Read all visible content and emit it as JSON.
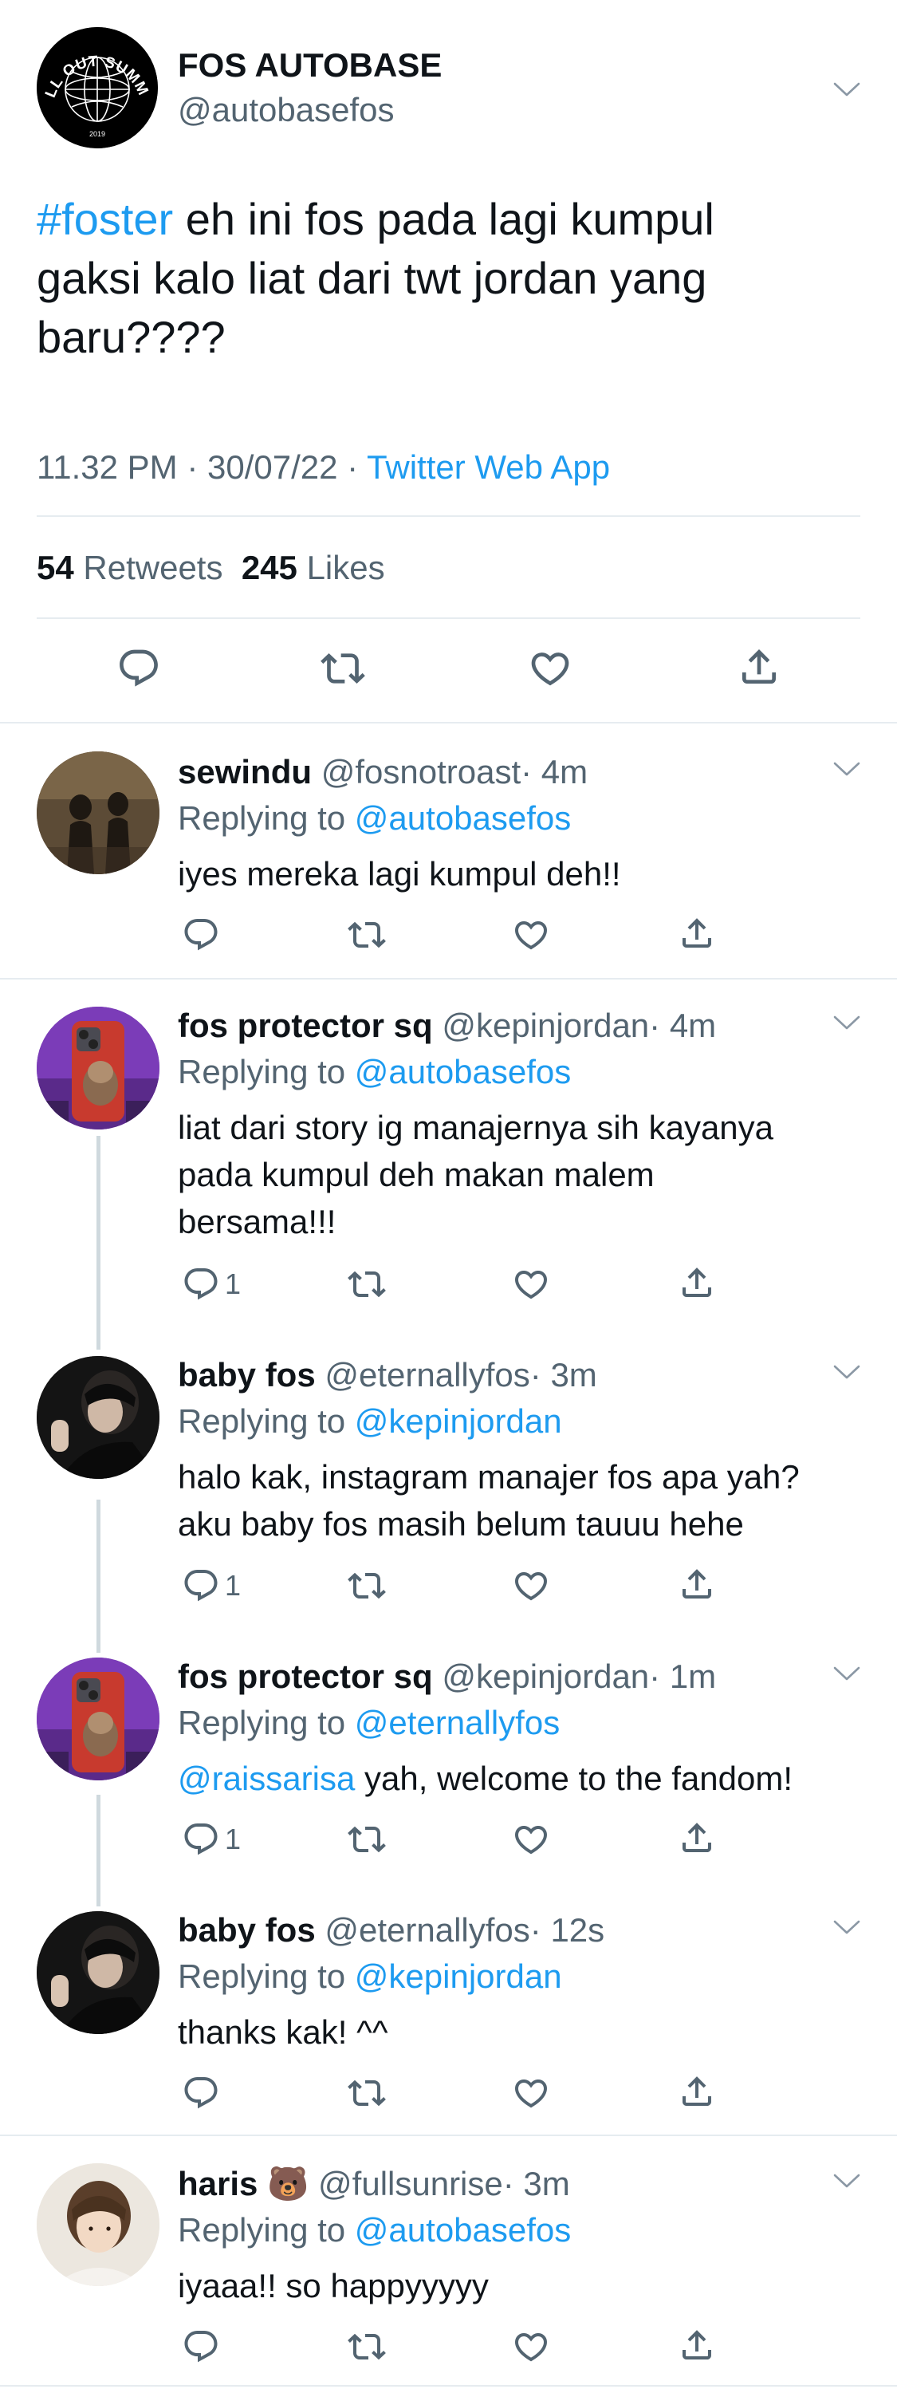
{
  "main_tweet": {
    "display_name": "FOS AUTOBASE",
    "handle": "@autobasefos",
    "avatar_text_top": "FALL OUT SUMMER",
    "avatar_text_bottom": "2019",
    "hashtag": "#foster",
    "text_line1": " eh ini fos pada lagi kumpul",
    "text_line2": "gaksi kalo liat dari twt jordan yang",
    "text_line3": "baru????",
    "timestamp": "11.32 PM · 30/07/22 · ",
    "source": "Twitter Web App",
    "retweets_count": "54",
    "retweets_label": "Retweets",
    "likes_count": "245",
    "likes_label": "Likes"
  },
  "replies": [
    {
      "display_name": "sewindu",
      "handle": "@fosnotroast",
      "time": "· 4m",
      "replying_prefix": "Replying to ",
      "replying_to": "@autobasefos",
      "lines": [
        "iyes mereka lagi kumpul deh!!"
      ],
      "reply_count": ""
    },
    {
      "display_name": "fos protector sq",
      "handle": "@kepinjordan",
      "time": "· 4m",
      "replying_prefix": "Replying to ",
      "replying_to": "@autobasefos",
      "lines": [
        "liat dari story ig manajernya sih kayanya",
        "pada kumpul deh makan malem",
        "bersama!!!"
      ],
      "reply_count": "1"
    },
    {
      "display_name": "baby fos",
      "handle": "@eternallyfos",
      "time": "· 3m",
      "replying_prefix": "Replying to ",
      "replying_to": "@kepinjordan",
      "lines": [
        "halo kak, instagram manajer fos apa yah?",
        "aku baby fos masih belum tauuu hehe"
      ],
      "reply_count": "1"
    },
    {
      "display_name": "fos protector sq",
      "handle": "@kepinjordan",
      "time": "· 1m",
      "replying_prefix": "Replying to ",
      "replying_to": "@eternallyfos",
      "mention": "@raissarisa",
      "lines": [
        " yah, welcome to the fandom!"
      ],
      "reply_count": "1"
    },
    {
      "display_name": "baby fos",
      "handle": "@eternallyfos",
      "time": "· 12s",
      "replying_prefix": "Replying to ",
      "replying_to": "@kepinjordan",
      "lines": [
        "thanks kak! ^^"
      ],
      "reply_count": ""
    },
    {
      "display_name": "haris",
      "emoji": "🐻",
      "handle": "@fullsunrise",
      "time": "· 3m",
      "replying_prefix": "Replying to ",
      "replying_to": "@autobasefos",
      "lines": [
        "iyaaa!! so happyyyyy"
      ],
      "reply_count": ""
    }
  ],
  "icons": [
    "chevron-down-icon",
    "reply-icon",
    "retweet-icon",
    "like-icon",
    "share-icon"
  ],
  "colors": {
    "accent": "#1d9bf0",
    "secondary_text": "#536471",
    "divider": "#e6ecf0",
    "thread_line": "#cfd9de"
  }
}
